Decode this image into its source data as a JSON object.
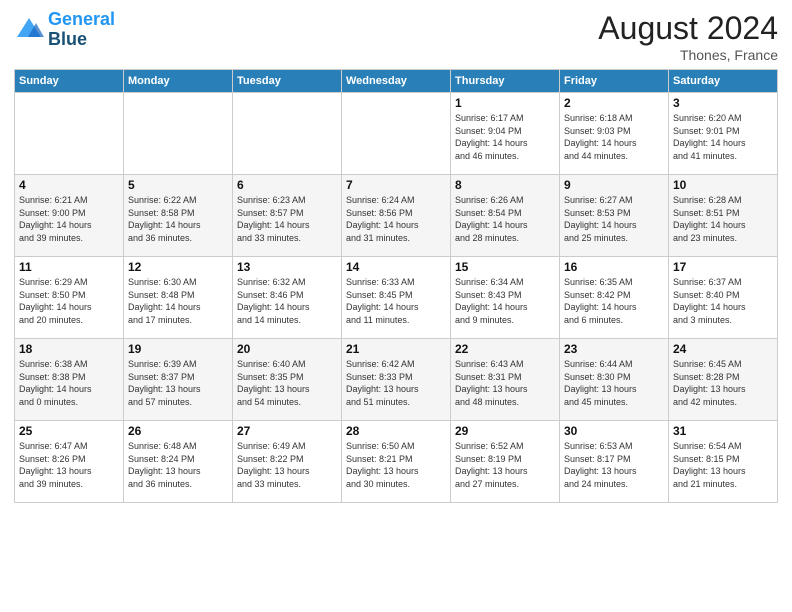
{
  "header": {
    "logo_line1": "General",
    "logo_line2": "Blue",
    "month": "August 2024",
    "location": "Thones, France"
  },
  "days_of_week": [
    "Sunday",
    "Monday",
    "Tuesday",
    "Wednesday",
    "Thursday",
    "Friday",
    "Saturday"
  ],
  "weeks": [
    [
      {
        "day": "",
        "info": ""
      },
      {
        "day": "",
        "info": ""
      },
      {
        "day": "",
        "info": ""
      },
      {
        "day": "",
        "info": ""
      },
      {
        "day": "1",
        "info": "Sunrise: 6:17 AM\nSunset: 9:04 PM\nDaylight: 14 hours\nand 46 minutes."
      },
      {
        "day": "2",
        "info": "Sunrise: 6:18 AM\nSunset: 9:03 PM\nDaylight: 14 hours\nand 44 minutes."
      },
      {
        "day": "3",
        "info": "Sunrise: 6:20 AM\nSunset: 9:01 PM\nDaylight: 14 hours\nand 41 minutes."
      }
    ],
    [
      {
        "day": "4",
        "info": "Sunrise: 6:21 AM\nSunset: 9:00 PM\nDaylight: 14 hours\nand 39 minutes."
      },
      {
        "day": "5",
        "info": "Sunrise: 6:22 AM\nSunset: 8:58 PM\nDaylight: 14 hours\nand 36 minutes."
      },
      {
        "day": "6",
        "info": "Sunrise: 6:23 AM\nSunset: 8:57 PM\nDaylight: 14 hours\nand 33 minutes."
      },
      {
        "day": "7",
        "info": "Sunrise: 6:24 AM\nSunset: 8:56 PM\nDaylight: 14 hours\nand 31 minutes."
      },
      {
        "day": "8",
        "info": "Sunrise: 6:26 AM\nSunset: 8:54 PM\nDaylight: 14 hours\nand 28 minutes."
      },
      {
        "day": "9",
        "info": "Sunrise: 6:27 AM\nSunset: 8:53 PM\nDaylight: 14 hours\nand 25 minutes."
      },
      {
        "day": "10",
        "info": "Sunrise: 6:28 AM\nSunset: 8:51 PM\nDaylight: 14 hours\nand 23 minutes."
      }
    ],
    [
      {
        "day": "11",
        "info": "Sunrise: 6:29 AM\nSunset: 8:50 PM\nDaylight: 14 hours\nand 20 minutes."
      },
      {
        "day": "12",
        "info": "Sunrise: 6:30 AM\nSunset: 8:48 PM\nDaylight: 14 hours\nand 17 minutes."
      },
      {
        "day": "13",
        "info": "Sunrise: 6:32 AM\nSunset: 8:46 PM\nDaylight: 14 hours\nand 14 minutes."
      },
      {
        "day": "14",
        "info": "Sunrise: 6:33 AM\nSunset: 8:45 PM\nDaylight: 14 hours\nand 11 minutes."
      },
      {
        "day": "15",
        "info": "Sunrise: 6:34 AM\nSunset: 8:43 PM\nDaylight: 14 hours\nand 9 minutes."
      },
      {
        "day": "16",
        "info": "Sunrise: 6:35 AM\nSunset: 8:42 PM\nDaylight: 14 hours\nand 6 minutes."
      },
      {
        "day": "17",
        "info": "Sunrise: 6:37 AM\nSunset: 8:40 PM\nDaylight: 14 hours\nand 3 minutes."
      }
    ],
    [
      {
        "day": "18",
        "info": "Sunrise: 6:38 AM\nSunset: 8:38 PM\nDaylight: 14 hours\nand 0 minutes."
      },
      {
        "day": "19",
        "info": "Sunrise: 6:39 AM\nSunset: 8:37 PM\nDaylight: 13 hours\nand 57 minutes."
      },
      {
        "day": "20",
        "info": "Sunrise: 6:40 AM\nSunset: 8:35 PM\nDaylight: 13 hours\nand 54 minutes."
      },
      {
        "day": "21",
        "info": "Sunrise: 6:42 AM\nSunset: 8:33 PM\nDaylight: 13 hours\nand 51 minutes."
      },
      {
        "day": "22",
        "info": "Sunrise: 6:43 AM\nSunset: 8:31 PM\nDaylight: 13 hours\nand 48 minutes."
      },
      {
        "day": "23",
        "info": "Sunrise: 6:44 AM\nSunset: 8:30 PM\nDaylight: 13 hours\nand 45 minutes."
      },
      {
        "day": "24",
        "info": "Sunrise: 6:45 AM\nSunset: 8:28 PM\nDaylight: 13 hours\nand 42 minutes."
      }
    ],
    [
      {
        "day": "25",
        "info": "Sunrise: 6:47 AM\nSunset: 8:26 PM\nDaylight: 13 hours\nand 39 minutes."
      },
      {
        "day": "26",
        "info": "Sunrise: 6:48 AM\nSunset: 8:24 PM\nDaylight: 13 hours\nand 36 minutes."
      },
      {
        "day": "27",
        "info": "Sunrise: 6:49 AM\nSunset: 8:22 PM\nDaylight: 13 hours\nand 33 minutes."
      },
      {
        "day": "28",
        "info": "Sunrise: 6:50 AM\nSunset: 8:21 PM\nDaylight: 13 hours\nand 30 minutes."
      },
      {
        "day": "29",
        "info": "Sunrise: 6:52 AM\nSunset: 8:19 PM\nDaylight: 13 hours\nand 27 minutes."
      },
      {
        "day": "30",
        "info": "Sunrise: 6:53 AM\nSunset: 8:17 PM\nDaylight: 13 hours\nand 24 minutes."
      },
      {
        "day": "31",
        "info": "Sunrise: 6:54 AM\nSunset: 8:15 PM\nDaylight: 13 hours\nand 21 minutes."
      }
    ]
  ]
}
